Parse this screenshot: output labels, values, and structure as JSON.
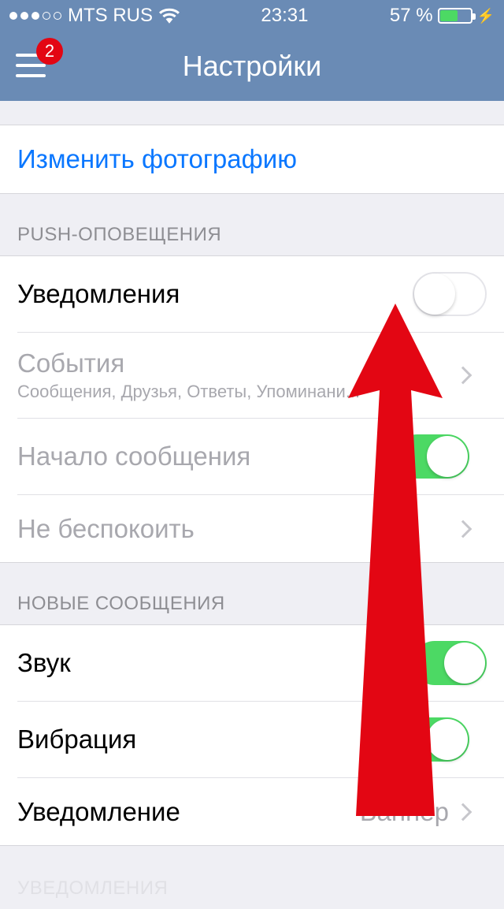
{
  "status": {
    "carrier": "MTS RUS",
    "time": "23:31",
    "battery_pct": "57 %"
  },
  "nav": {
    "title": "Настройки",
    "badge": "2"
  },
  "photo_link": "Изменить фотографию",
  "sections": {
    "push": {
      "header": "PUSH-ОПОВЕЩЕНИЯ",
      "notifications": "Уведомления",
      "events": "События",
      "events_sub": "Сообщения, Друзья, Ответы, Упоминани...",
      "message_preview": "Начало сообщения",
      "dnd": "Не беспокоить"
    },
    "new_msgs": {
      "header": "НОВЫЕ СООБЩЕНИЯ",
      "sound": "Звук",
      "vibration": "Вибрация",
      "notification": "Уведомление",
      "notification_value": "Баннер"
    },
    "bottom": {
      "header": "УВЕДОМЛЕНИЯ"
    }
  }
}
